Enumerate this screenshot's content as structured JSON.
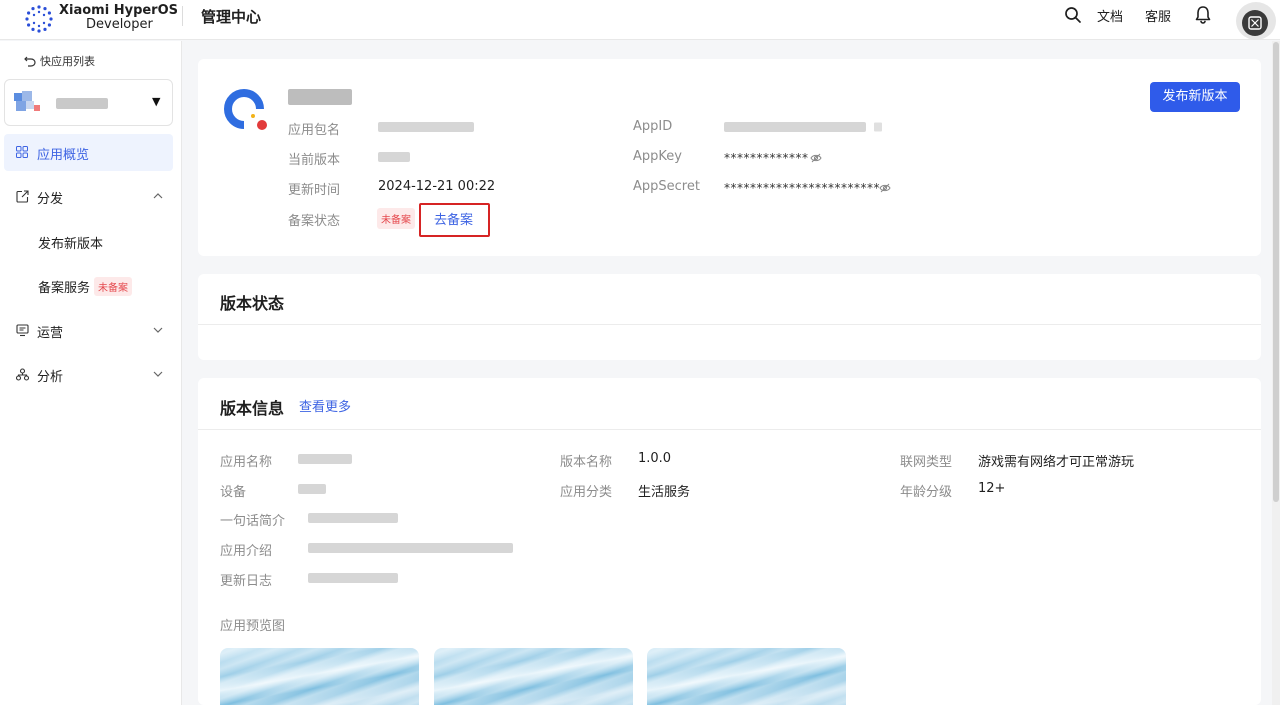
{
  "header": {
    "brand_line1": "Xiaomi HyperOS",
    "brand_line2": "Developer",
    "title": "管理中心",
    "docs": "文档",
    "service": "客服",
    "icons": [
      "search-icon",
      "bell-icon",
      "avatar"
    ]
  },
  "sidebar": {
    "back_label": "快应用列表",
    "overview_label": "应用概览",
    "distribute_label": "分发",
    "publish_label": "发布新版本",
    "filing_label": "备案服务",
    "filing_badge": "未备案",
    "operations_label": "运营",
    "analytics_label": "分析"
  },
  "overview": {
    "package_label": "应用包名",
    "version_label": "当前版本",
    "updated_label": "更新时间",
    "updated_value": "2024-12-21 00:22",
    "filing_status_label": "备案状态",
    "filing_status_value": "未备案",
    "go_filing": "去备案",
    "appid_label": "AppID",
    "appkey_label": "AppKey",
    "appkey_value": "*************",
    "appsecret_label": "AppSecret",
    "appsecret_value": "************************",
    "publish_button": "发布新版本"
  },
  "version_status": {
    "title": "版本状态"
  },
  "version_info": {
    "title": "版本信息",
    "more_link": "查看更多",
    "app_name_label": "应用名称",
    "device_label": "设备",
    "tagline_label": "一句话简介",
    "intro_label": "应用介绍",
    "changelog_label": "更新日志",
    "version_name_label": "版本名称",
    "version_name_value": "1.0.0",
    "category_label": "应用分类",
    "category_value": "生活服务",
    "network_label": "联网类型",
    "network_value": "游戏需有网络才可正常游玩",
    "age_label": "年龄分级",
    "age_value": "12+",
    "preview_label": "应用预览图"
  },
  "colors": {
    "accent": "#2f5bea",
    "link": "#3e64e3",
    "danger": "#e5484d",
    "highlight_box": "#d62424"
  }
}
